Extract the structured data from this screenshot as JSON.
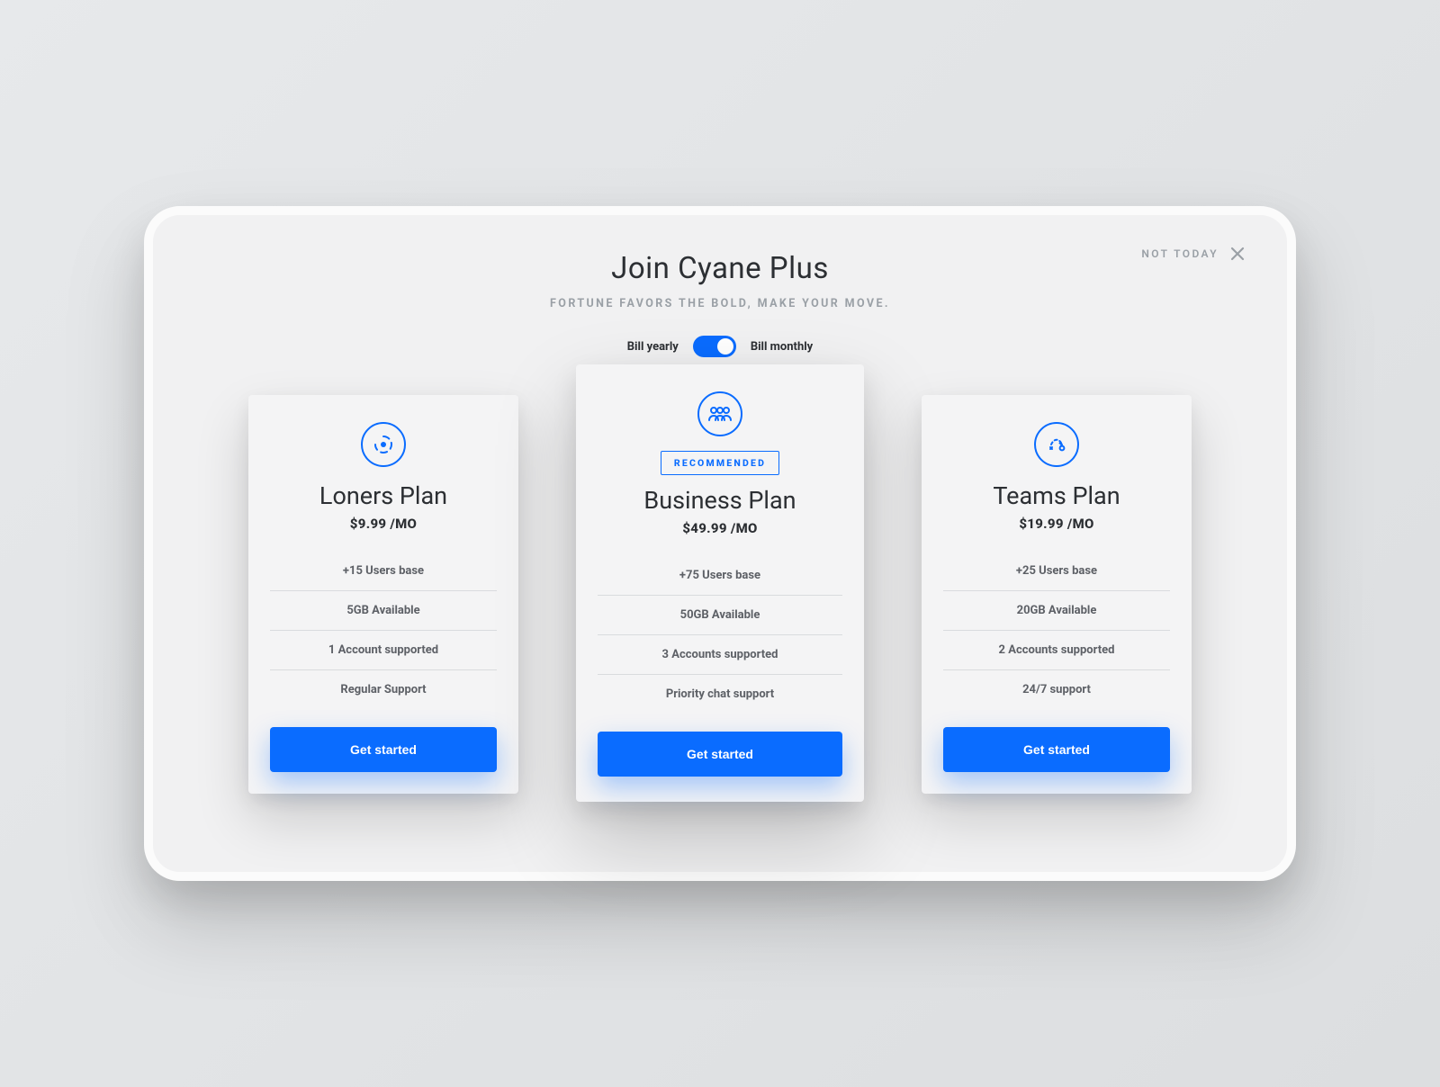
{
  "close": {
    "label": "NOT TODAY"
  },
  "header": {
    "title": "Join Cyane Plus",
    "subtitle": "FORTUNE FAVORS THE BOLD, MAKE YOUR MOVE."
  },
  "billing": {
    "left": "Bill yearly",
    "right": "Bill monthly",
    "selected": "monthly"
  },
  "colors": {
    "accent": "#0a6cff"
  },
  "plans": [
    {
      "id": "loners",
      "icon": "target-icon",
      "name": "Loners Plan",
      "price": "$9.99 /MO",
      "features": [
        "+15 Users base",
        "5GB Available",
        "1 Account supported",
        "Regular Support"
      ],
      "cta": "Get started",
      "featured": false
    },
    {
      "id": "business",
      "icon": "team-icon",
      "badge": "RECOMMENDED",
      "name": "Business Plan",
      "price": "$49.99 /MO",
      "features": [
        "+75 Users base",
        "50GB Available",
        "3 Accounts supported",
        "Priority chat support"
      ],
      "cta": "Get started",
      "featured": true
    },
    {
      "id": "teams",
      "icon": "strategy-icon",
      "name": "Teams Plan",
      "price": "$19.99 /MO",
      "features": [
        "+25 Users base",
        "20GB Available",
        "2 Accounts supported",
        "24/7 support"
      ],
      "cta": "Get started",
      "featured": false
    }
  ]
}
